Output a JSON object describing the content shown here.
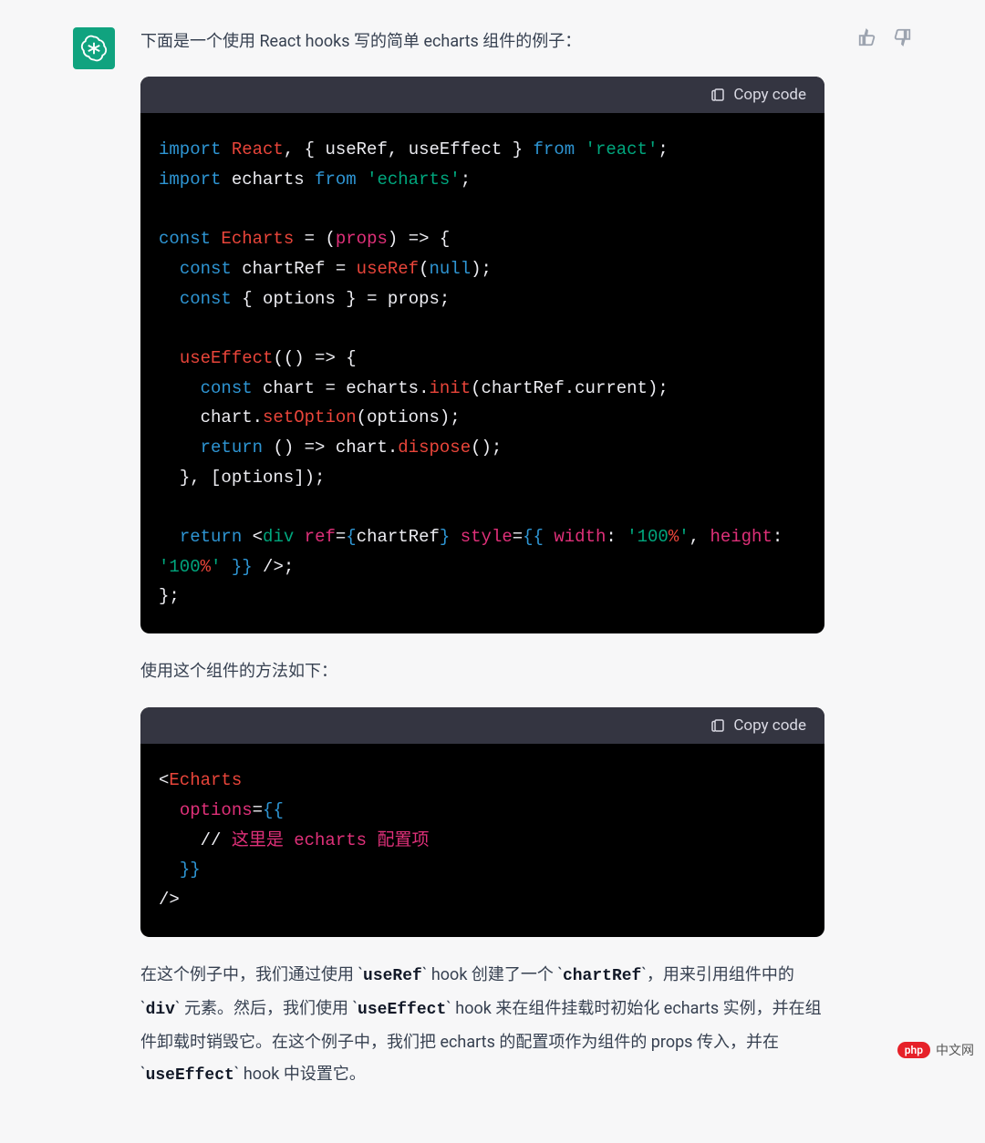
{
  "message": {
    "intro": "下面是一个使用 React hooks 写的简单 echarts 组件的例子：",
    "paragraph2": "使用这个组件的方法如下：",
    "explanation": {
      "t0": "在这个例子中，我们通过使用 `",
      "c0": "useRef",
      "t1": "` hook 创建了一个 `",
      "c1": "chartRef",
      "t2": "`，用来引用组件中的 `",
      "c2": "div",
      "t3": "` 元素。然后，我们使用 `",
      "c3": "useEffect",
      "t4": "` hook 来在组件挂载时初始化 echarts 实例，并在组件卸载时销毁它。在这个例子中，我们把 echarts 的配置项作为组件的 props 传入，并在 `",
      "c4": "useEffect",
      "t5": "` hook 中设置它。"
    }
  },
  "code_header": {
    "copy_label": "Copy code"
  },
  "code1": {
    "l1_import": "import",
    "l1_react": "React",
    "l1_useRef": "useRef",
    "l1_useEffect": "useEffect",
    "l1_from": "from",
    "l1_pkg": "'react'",
    "l2_import": "import",
    "l2_echarts": "echarts",
    "l2_from": "from",
    "l2_pkg": "'echarts'",
    "l4_const": "const",
    "l4_name": "Echarts",
    "l4_props": "props",
    "l5_const": "const",
    "l5_var": "chartRef",
    "l5_useRef": "useRef",
    "l5_null": "null",
    "l6_const": "const",
    "l6_options": "options",
    "l6_props": "props",
    "l8_useEffect": "useEffect",
    "l9_const": "const",
    "l9_chart": "chart",
    "l9_echarts": "echarts",
    "l9_init": "init",
    "l9_arg1": "chartRef",
    "l9_arg2": "current",
    "l10_chart": "chart",
    "l10_setOption": "setOption",
    "l10_arg": "options",
    "l11_return": "return",
    "l11_chart": "chart",
    "l11_dispose": "dispose",
    "l12_options": "options",
    "l14_return": "return",
    "l14_tag_open": "<",
    "l14_div": "div",
    "l14_ref": "ref",
    "l14_chartRef": "chartRef",
    "l14_style": "style",
    "l14_width": "width",
    "l14_100a": "'100%'",
    "l14_height": "height",
    "l14_100b": "'100%'",
    "l14_close": "/>"
  },
  "code2": {
    "l1_open": "<",
    "l1_tag": "Echarts",
    "l2_options": "options",
    "l3_comment_txt": "这里是 echarts 配置项",
    "l5_close": "/>"
  },
  "watermark": {
    "badge": "php",
    "text": "中文网"
  }
}
